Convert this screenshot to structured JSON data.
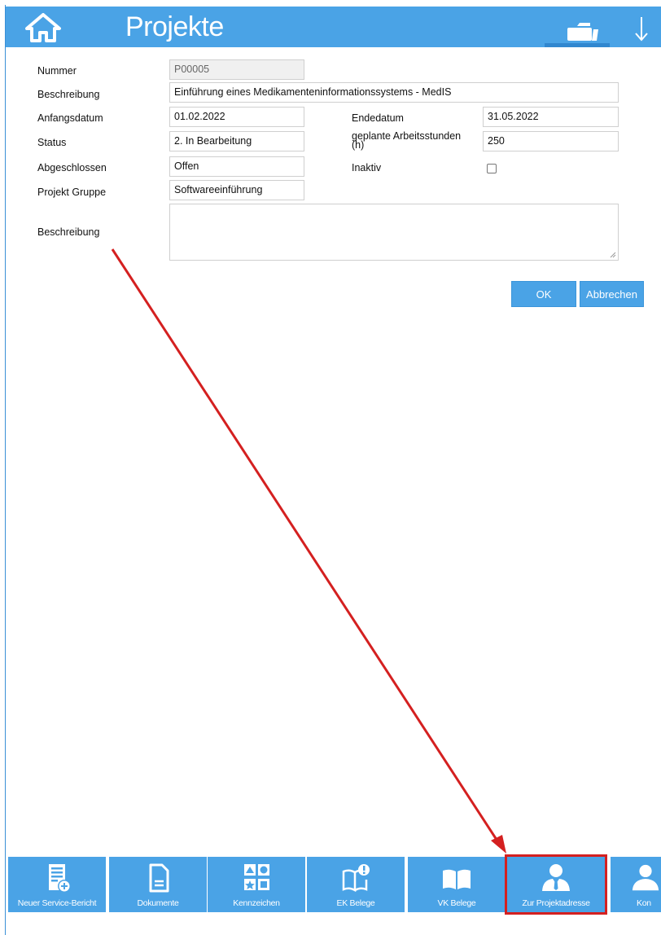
{
  "header": {
    "title": "Projekte"
  },
  "form": {
    "nummer": {
      "label": "Nummer",
      "value": "P00005"
    },
    "beschreibung": {
      "label": "Beschreibung",
      "value": "Einführung eines Medikamenteninformationssystems - MedIS"
    },
    "anfangsdatum": {
      "label": "Anfangsdatum",
      "value": "01.02.2022"
    },
    "endedatum": {
      "label": "Endedatum",
      "value": "31.05.2022"
    },
    "status": {
      "label": "Status",
      "value": "2. In Bearbeitung"
    },
    "stunden": {
      "label": "geplante Arbeitsstunden (h)",
      "value": "250"
    },
    "abgeschlossen": {
      "label": "Abgeschlossen",
      "value": "Offen"
    },
    "inaktiv": {
      "label": "Inaktiv",
      "checked": false
    },
    "gruppe": {
      "label": "Projekt Gruppe",
      "value": "Softwareeinführung"
    },
    "beschreibung2": {
      "label": "Beschreibung",
      "value": ""
    }
  },
  "buttons": {
    "ok": "OK",
    "cancel": "Abbrechen"
  },
  "toolbar": {
    "items": [
      {
        "label": "Neuer Service-Bericht",
        "icon": "new-service-report-icon"
      },
      {
        "label": "Dokumente",
        "icon": "document-icon"
      },
      {
        "label": "Kennzeichen",
        "icon": "flags-icon"
      },
      {
        "label": "EK Belege",
        "icon": "purchase-receipts-icon"
      },
      {
        "label": "VK Belege",
        "icon": "sales-receipts-icon"
      },
      {
        "label": "Zur Projektadresse",
        "icon": "person-icon"
      },
      {
        "label": "Kon",
        "icon": "contact-icon"
      }
    ]
  },
  "colors": {
    "accent": "#4aa3e6",
    "highlight": "#d42020"
  }
}
